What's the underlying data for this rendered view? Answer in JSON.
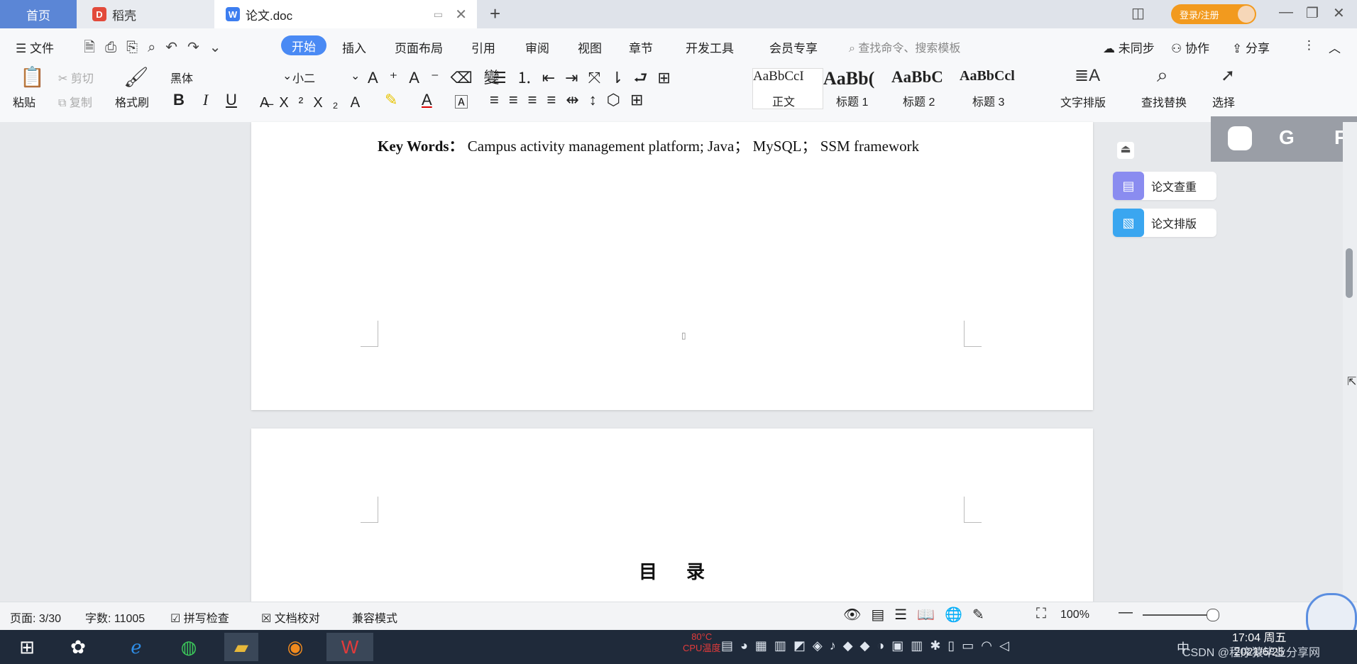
{
  "tabs": {
    "home": "首页",
    "daoke": "稻壳",
    "doc": "论文.doc",
    "login": "登录/注册"
  },
  "menu": {
    "file": "文件",
    "start": "开始",
    "insert": "插入",
    "layout": "页面布局",
    "references": "引用",
    "review": "审阅",
    "view": "视图",
    "chapter": "章节",
    "devtools": "开发工具",
    "member": "会员专享",
    "search_placeholder": "查找命令、搜索模板",
    "sync": "未同步",
    "collab": "协作",
    "share": "分享"
  },
  "ribbon": {
    "paste": "粘贴",
    "cut": "剪切",
    "copy": "复制",
    "format_painter": "格式刷",
    "font_name": "黑体",
    "font_size": "小二",
    "styles": [
      {
        "preview": "AaBbCcI",
        "label": "正文"
      },
      {
        "preview": "AaBb(",
        "label": "标题 1"
      },
      {
        "preview": "AaBbC",
        "label": "标题 2"
      },
      {
        "preview": "AaBbCcl",
        "label": "标题 3"
      }
    ],
    "text_layout": "文字排版",
    "find_replace": "查找替换",
    "select": "选择"
  },
  "document": {
    "keywords_label": "Key Words：",
    "keywords_text": "Campus activity management platform; Java； MySQL； SSM framework",
    "toc_title": "目 录"
  },
  "side_panel": {
    "check": "论文查重",
    "layout": "论文排版"
  },
  "status": {
    "page": "页面: 3/30",
    "words": "字数: 11005",
    "spell": "拼写检查",
    "proof": "文档校对",
    "compat": "兼容模式",
    "zoom": "100%"
  },
  "taskbar": {
    "cpu_temp": "80°C",
    "cpu_label": "CPU温度",
    "time": "17:04 周五",
    "date": "2021/6/25",
    "watermark": "CSDN @程序猿毕业分享网"
  }
}
